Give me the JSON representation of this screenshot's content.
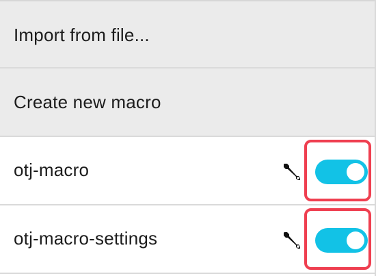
{
  "menu": {
    "actions": [
      {
        "label": "Import from file..."
      },
      {
        "label": "Create new macro"
      }
    ],
    "macros": [
      {
        "name": "otj-macro",
        "enabled": true,
        "edit_icon": "wrench-icon"
      },
      {
        "name": "otj-macro-settings",
        "enabled": true,
        "edit_icon": "wrench-icon"
      }
    ]
  },
  "colors": {
    "toggle_on": "#12c2e6",
    "highlight_border": "#ef3f50",
    "action_row_bg": "#ebebeb"
  }
}
